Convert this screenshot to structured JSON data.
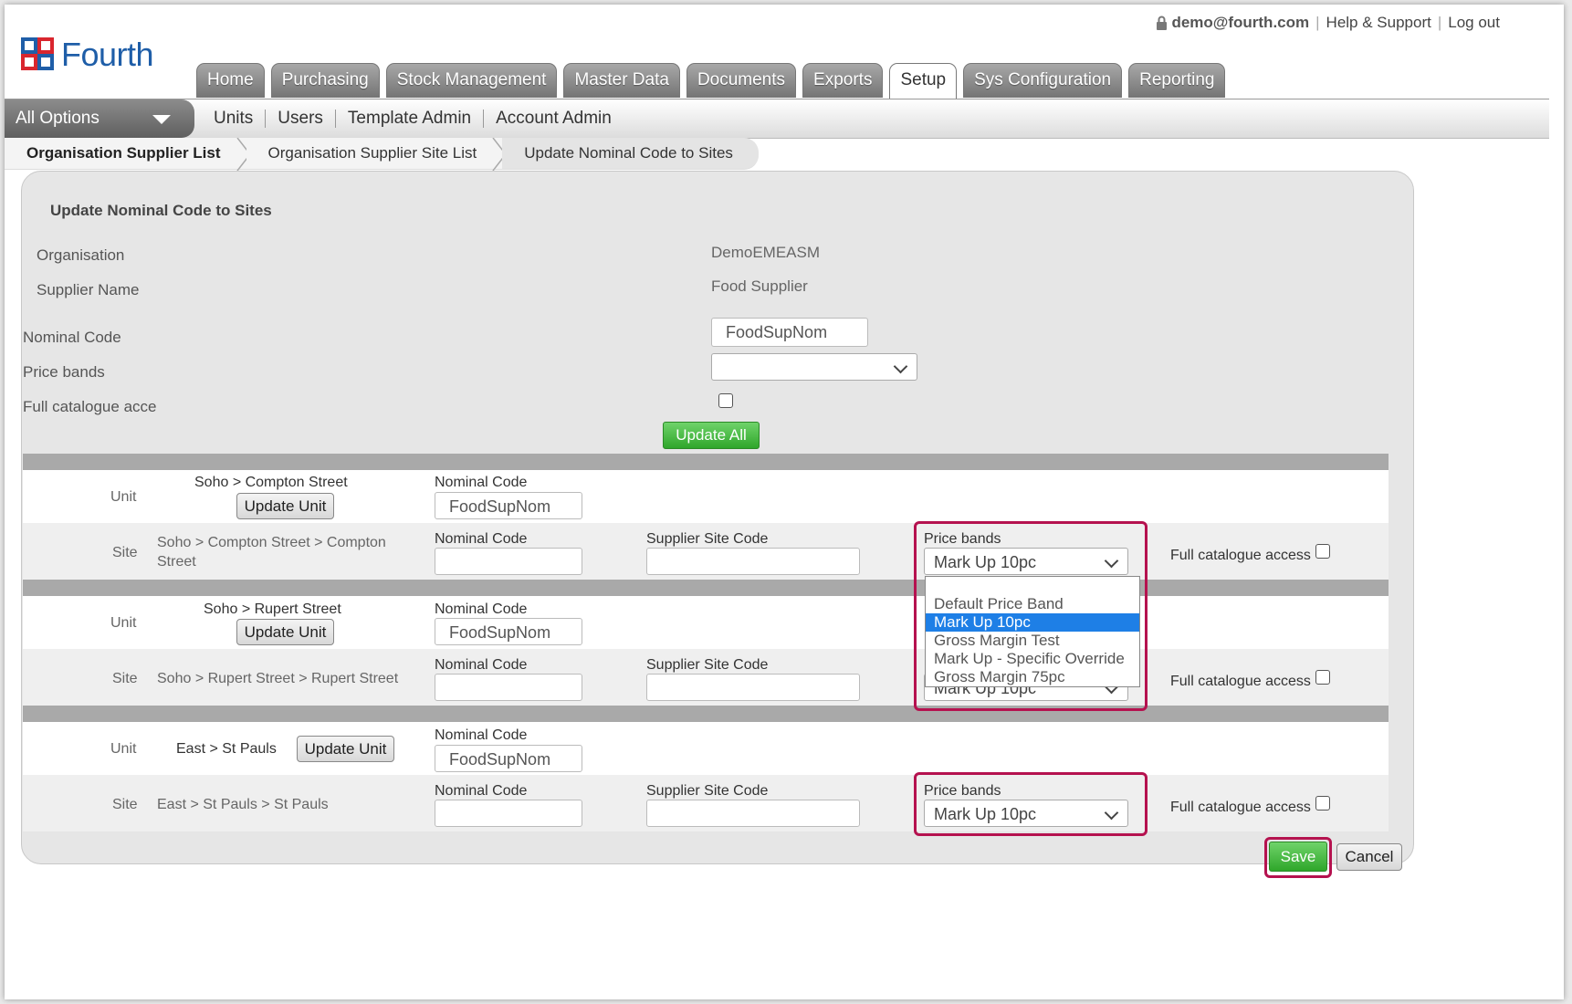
{
  "header": {
    "brand": "Fourth",
    "user_email": "demo@fourth.com",
    "help_link": "Help & Support",
    "logout_link": "Log out"
  },
  "nav": {
    "tabs": [
      {
        "label": "Home"
      },
      {
        "label": "Purchasing"
      },
      {
        "label": "Stock Management"
      },
      {
        "label": "Master Data"
      },
      {
        "label": "Documents"
      },
      {
        "label": "Exports"
      },
      {
        "label": "Setup",
        "active": true
      },
      {
        "label": "Sys Configuration"
      },
      {
        "label": "Reporting"
      }
    ],
    "all_options": "All Options",
    "subnav": [
      "Units",
      "Users",
      "Template Admin",
      "Account Admin"
    ]
  },
  "breadcrumb": [
    "Organisation Supplier List",
    "Organisation Supplier Site List",
    "Update Nominal Code to Sites"
  ],
  "form": {
    "title": "Update Nominal Code to Sites",
    "organisation_label": "Organisation",
    "organisation_value": "DemoEMEASM",
    "supplier_label": "Supplier Name",
    "supplier_value": "Food Supplier",
    "nominal_label": "Nominal Code",
    "nominal_value": "FoodSupNom",
    "price_bands_label": "Price bands",
    "price_bands_value": "",
    "full_catalogue_label": "Full catalogue access",
    "update_all_label": "Update All"
  },
  "labels": {
    "unit": "Unit",
    "site": "Site",
    "nominal_code": "Nominal Code",
    "supplier_site_code": "Supplier Site Code",
    "price_bands": "Price bands",
    "full_catalogue_access": "Full catalogue access",
    "update_unit": "Update Unit"
  },
  "units": [
    {
      "unit_path": "Soho > Compton Street",
      "unit_nominal": "FoodSupNom",
      "site_path_1": "Soho > Compton Street > Compton",
      "site_path_2": "Street",
      "site_nominal": "",
      "supplier_site_code": "",
      "price_band": "Mark Up 10pc"
    },
    {
      "unit_path": "Soho > Rupert Street",
      "unit_nominal": "FoodSupNom",
      "site_path_1": "Soho > Rupert Street > Rupert Street",
      "site_path_2": "",
      "site_nominal": "",
      "supplier_site_code": "",
      "price_band": "Mark Up 10pc"
    },
    {
      "unit_path": "East > St Pauls",
      "unit_nominal": "FoodSupNom",
      "site_path_1": "East > St Pauls > St Pauls",
      "site_path_2": "",
      "site_nominal": "",
      "supplier_site_code": "",
      "price_band": "Mark Up 10pc"
    }
  ],
  "dropdown_options": [
    "",
    "Default Price Band",
    "Mark Up 10pc",
    "Gross Margin Test",
    "Mark Up - Specific Override",
    "Gross Margin 75pc"
  ],
  "actions": {
    "save": "Save",
    "cancel": "Cancel"
  },
  "colors": {
    "highlight": "#b5124f",
    "brand": "#1f5ea8",
    "green": "#2fa62a",
    "selected": "#1e7fe6"
  }
}
